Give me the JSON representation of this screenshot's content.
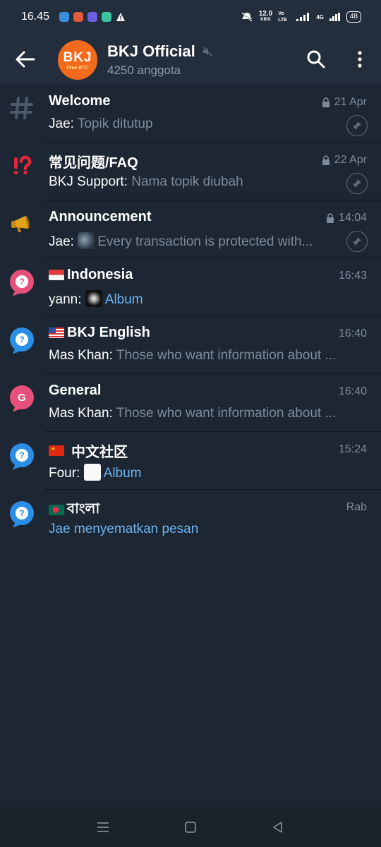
{
  "status": {
    "time": "16.45",
    "speed": "12.0",
    "speed_unit": "KB/S",
    "volte": "Vo LTE",
    "net": "4G",
    "battery": "48"
  },
  "header": {
    "title": "BKJ Official",
    "logo_text": "BKJ",
    "logo_sub": "Free BTC",
    "subtitle": "4250 anggota"
  },
  "topics": [
    {
      "name": "Welcome",
      "time": "21 Apr",
      "locked": true,
      "pinned": true,
      "sender": "Jae:",
      "message": "Topik ditutup",
      "icon": "hash-icon"
    },
    {
      "name": "常见问题/FAQ",
      "time": "22 Apr",
      "locked": true,
      "pinned": true,
      "sender": "BKJ Support:",
      "message": "Nama topik diubah",
      "icon": "exclamation-question-icon"
    },
    {
      "name": "Announcement",
      "time": "14:04",
      "locked": true,
      "pinned": true,
      "sender": "Jae:",
      "message": "Every transaction is protected with...",
      "icon": "megaphone-icon"
    },
    {
      "name": "Indonesia",
      "time": "16:43",
      "sender": "yann:",
      "message": "Album",
      "icon": "topic-bubble-pink-icon"
    },
    {
      "name": "BKJ English",
      "time": "16:40",
      "sender": "Mas Khan:",
      "message": "Those who want information about ...",
      "icon": "topic-bubble-blue-icon"
    },
    {
      "name": "General",
      "time": "16:40",
      "sender": "Mas Khan:",
      "message": "Those who want information about ...",
      "icon": "topic-bubble-general-icon",
      "letter": "G"
    },
    {
      "name": "中文社区",
      "time": "15:24",
      "sender": "Four:",
      "message": "Album",
      "icon": "topic-bubble-blue-icon"
    },
    {
      "name": "বাংলা",
      "time": "Rab",
      "sender": "",
      "message": "Jae menyematkan pesan",
      "icon": "topic-bubble-blue-icon"
    }
  ],
  "colors": {
    "background": "#1d2733",
    "header": "#232e3c",
    "accent_link": "#6cb3f0",
    "muted": "#7d8b99",
    "logo": "#f26b1d"
  }
}
